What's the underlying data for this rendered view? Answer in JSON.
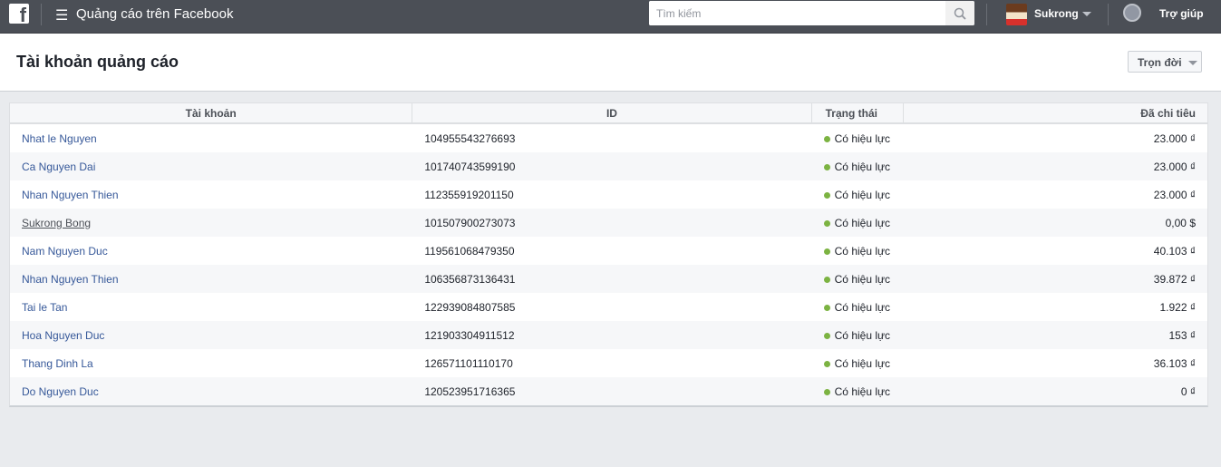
{
  "topbar": {
    "logo": "f",
    "app_title": "Quảng cáo trên Facebook",
    "search_placeholder": "Tìm kiếm",
    "user": "Sukrong",
    "help": "Trợ giúp"
  },
  "header": {
    "title": "Tài khoản quảng cáo",
    "range": "Trọn đời"
  },
  "table": {
    "columns": [
      "Tài khoản",
      "ID",
      "Trạng thái",
      "Đã chi tiêu"
    ],
    "rows": [
      {
        "name": "Nhat le Nguyen",
        "id": "104955543276693",
        "status": "Có hiệu lực",
        "spent": "23.000 ₫"
      },
      {
        "name": "Ca Nguyen Dai",
        "id": "101740743599190",
        "status": "Có hiệu lực",
        "spent": "23.000 ₫"
      },
      {
        "name": "Nhan Nguyen Thien",
        "id": "112355919201150",
        "status": "Có hiệu lực",
        "spent": "23.000 ₫"
      },
      {
        "name": "Sukrong Bong",
        "id": "101507900273073",
        "status": "Có hiệu lực",
        "spent": "0,00 $"
      },
      {
        "name": "Nam Nguyen Duc",
        "id": "119561068479350",
        "status": "Có hiệu lực",
        "spent": "40.103 ₫"
      },
      {
        "name": "Nhan Nguyen Thien",
        "id": "106356873136431",
        "status": "Có hiệu lực",
        "spent": "39.872 ₫"
      },
      {
        "name": "Tai le Tan",
        "id": "122939084807585",
        "status": "Có hiệu lực",
        "spent": "1.922 ₫"
      },
      {
        "name": "Hoa Nguyen Duc",
        "id": "121903304911512",
        "status": "Có hiệu lực",
        "spent": "153 ₫"
      },
      {
        "name": "Thang Dinh La",
        "id": "126571101110170",
        "status": "Có hiệu lực",
        "spent": "36.103 ₫"
      },
      {
        "name": "Do Nguyen Duc",
        "id": "120523951716365",
        "status": "Có hiệu lực",
        "spent": "0 ₫"
      }
    ]
  }
}
